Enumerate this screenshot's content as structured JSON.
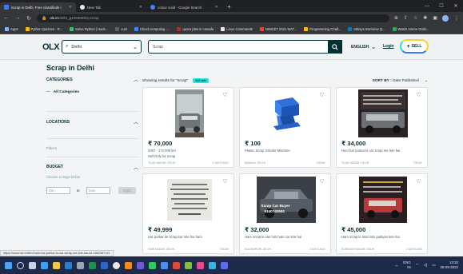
{
  "browser": {
    "tabs": [
      {
        "title": "Scrap in Delhi, Free classifieds i",
        "active": true
      },
      {
        "title": "New Tab",
        "active": false
      },
      {
        "title": "colour soiid - Google Search",
        "active": false
      }
    ],
    "url_host": "olx.in",
    "url_path": "/delhi_g4058659/q-scrap",
    "bookmarks": [
      "Apps",
      "Python Quizzes - R...",
      "Solve Python | Hack...",
      "cust",
      "Cloud computing -...",
      "quora jobs in canada",
      "Linux Commands",
      "NIMCET 2021 MAT...",
      "Programming Chall...",
      "Infosys Interview Q...",
      "Watch Anime Onlin..."
    ]
  },
  "header": {
    "logo": "OLX",
    "location": "Delhi",
    "search_value": "Scrap",
    "language": "ENGLISH",
    "login": "Login",
    "sell": "SELL"
  },
  "page": {
    "title": "Scrap in Delhi",
    "results_label": "Showing results for \"scrap\"",
    "results_badge": "226 ads",
    "sort_label": "SORT BY :",
    "sort_value": "Date Published"
  },
  "sidebar": {
    "categories_title": "CATEGORIES",
    "all_categories": "All Categories",
    "locations_title": "LOCATIONS",
    "filters": "Filters",
    "budget_title": "BUDGET",
    "budget_hint": "Choose a range below",
    "min_placeholder": "min",
    "to_label": "to",
    "max_placeholder": "max",
    "apply": "Apply"
  },
  "listings": [
    {
      "price": "₹ 70,000",
      "line1": "2007 - 172,000 km",
      "line2": "Sell Only for scrap",
      "location": "TILAK NAGAR, DELHI",
      "date": "2 DAYS AGO"
    },
    {
      "price": "₹ 100",
      "line1": "Plastic Scrap Grinder Machine",
      "line2": "",
      "location": "BAWALA, DELHI",
      "date": "TODAY"
    },
    {
      "price": "₹ 34,000",
      "line1": "Hum har purkar ki car scrap me lete hai",
      "line2": "",
      "location": "TILAK NAGAR, DELHI",
      "date": "TODAY"
    },
    {
      "price": "₹ 49,999",
      "line1": "Har parkar ke scrap kar lete hai ham",
      "line2": "",
      "location": "HARI NAGAR, DELHI",
      "date": "TODAY"
    },
    {
      "price": "₹ 32,000",
      "line1": "Ham scrap ki sari hoti hain car lete hai",
      "line2": "",
      "location": "SULTANPURI, DELHI",
      "date": "2 DAYS AGO"
    },
    {
      "price": "₹ 45,000",
      "line1": "Ham scrap ki total loss gadiyan lete hai",
      "line2": "",
      "location": "SUBHASH NAGAR, DELHI",
      "date": "2 DAYS AGO"
    }
  ],
  "image_texts": {
    "car_banner": "Scrap Car Buyer",
    "car_phone": "9340742691"
  },
  "status_url": "https://www.olx.in/item/ham-har-parkar-ki-car-scrap-me-lete-hai-iid-1662387131",
  "taskbar": {
    "lang": "ENG",
    "region": "IN",
    "time": "13:32",
    "date": "28-09-2022"
  },
  "colors": {
    "olx_dark": "#002f34",
    "sell_yellow": "#ffce32",
    "sell_teal": "#23e5db",
    "sell_blue": "#3a77ff"
  }
}
